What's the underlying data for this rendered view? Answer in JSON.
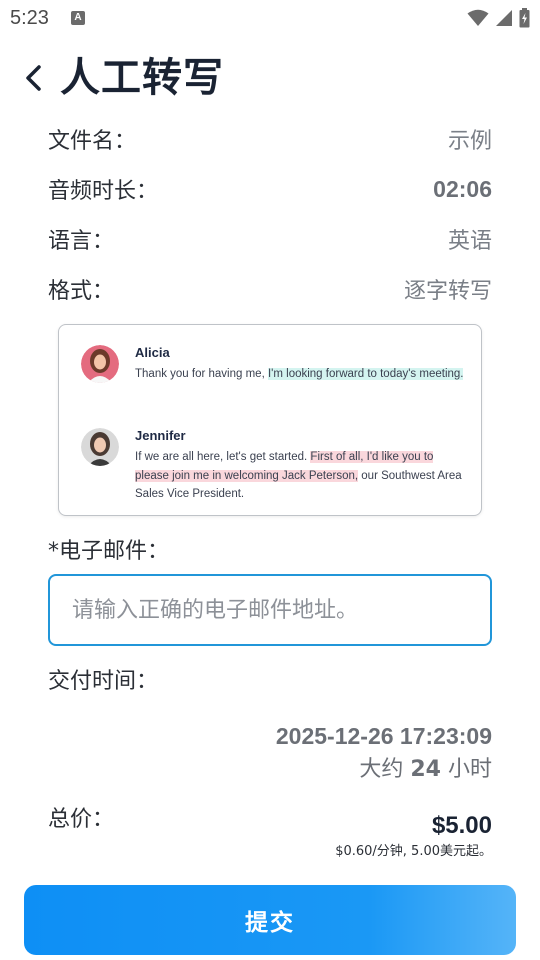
{
  "status_bar": {
    "time": "5:23",
    "notification_letter": "A",
    "icons": [
      "wifi-icon",
      "signal-icon",
      "battery-charging-icon"
    ]
  },
  "header": {
    "back_icon": "chevron-left-icon",
    "title": "人工转写"
  },
  "info": {
    "file_name": {
      "label": "文件名：",
      "value": "示例"
    },
    "duration": {
      "label": "音频时长：",
      "value": "02:06"
    },
    "language": {
      "label": "语言：",
      "value": "英语"
    },
    "format": {
      "label": "格式：",
      "value": "逐字转写"
    }
  },
  "preview": {
    "speakers": [
      {
        "name": "Alicia",
        "text_plain": "Thank you for having me, ",
        "text_highlight": "I'm looking forward to today's meeting."
      },
      {
        "name": "Jennifer",
        "text_plain": "If we are all here, let's get started. ",
        "text_highlight": "First of all, I'd like you to please join me in welcoming Jack Peterson,",
        "text_tail": " our Southwest Area Sales Vice President."
      }
    ],
    "colors": {
      "teal_highlight": "#d4f4f0",
      "pink_highlight": "#fad7dc"
    }
  },
  "email": {
    "label": "*电子邮件：",
    "value": "",
    "placeholder": "请输入正确的电子邮件地址。"
  },
  "delivery": {
    "label": "交付时间：",
    "datetime": "2025-12-26 17:23:09",
    "approx_prefix": "大约 ",
    "approx_hours": "24",
    "approx_suffix": " 小时"
  },
  "total": {
    "label": "总价：",
    "price": "$5.00",
    "note": "$0.60/分钟, 5.00美元起。"
  },
  "submit": {
    "label": "提交"
  },
  "colors": {
    "accent": "#1a98f5",
    "input_border": "#2196d9",
    "title": "#1a2333"
  }
}
